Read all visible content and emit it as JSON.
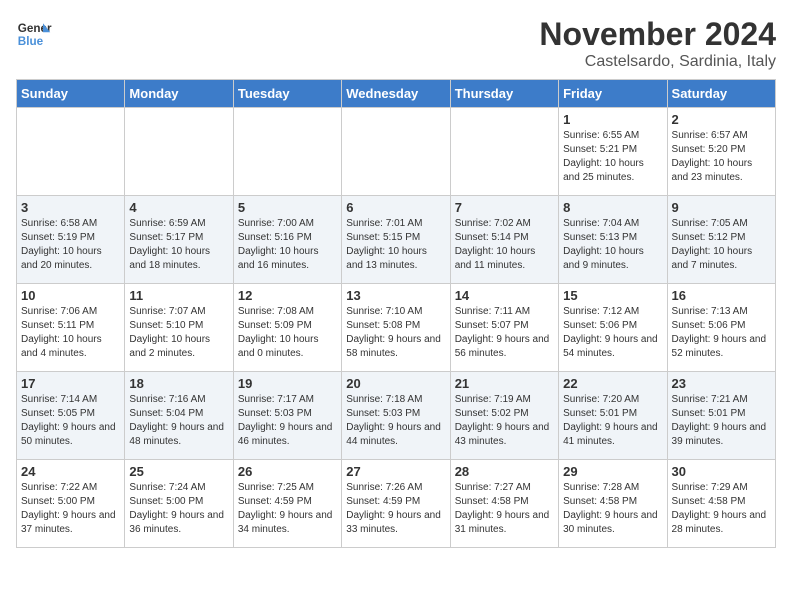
{
  "logo": {
    "name_line1": "General",
    "name_line2": "Blue"
  },
  "title": "November 2024",
  "location": "Castelsardo, Sardinia, Italy",
  "weekdays": [
    "Sunday",
    "Monday",
    "Tuesday",
    "Wednesday",
    "Thursday",
    "Friday",
    "Saturday"
  ],
  "weeks": [
    [
      {
        "day": "",
        "info": ""
      },
      {
        "day": "",
        "info": ""
      },
      {
        "day": "",
        "info": ""
      },
      {
        "day": "",
        "info": ""
      },
      {
        "day": "",
        "info": ""
      },
      {
        "day": "1",
        "info": "Sunrise: 6:55 AM\nSunset: 5:21 PM\nDaylight: 10 hours and 25 minutes."
      },
      {
        "day": "2",
        "info": "Sunrise: 6:57 AM\nSunset: 5:20 PM\nDaylight: 10 hours and 23 minutes."
      }
    ],
    [
      {
        "day": "3",
        "info": "Sunrise: 6:58 AM\nSunset: 5:19 PM\nDaylight: 10 hours and 20 minutes."
      },
      {
        "day": "4",
        "info": "Sunrise: 6:59 AM\nSunset: 5:17 PM\nDaylight: 10 hours and 18 minutes."
      },
      {
        "day": "5",
        "info": "Sunrise: 7:00 AM\nSunset: 5:16 PM\nDaylight: 10 hours and 16 minutes."
      },
      {
        "day": "6",
        "info": "Sunrise: 7:01 AM\nSunset: 5:15 PM\nDaylight: 10 hours and 13 minutes."
      },
      {
        "day": "7",
        "info": "Sunrise: 7:02 AM\nSunset: 5:14 PM\nDaylight: 10 hours and 11 minutes."
      },
      {
        "day": "8",
        "info": "Sunrise: 7:04 AM\nSunset: 5:13 PM\nDaylight: 10 hours and 9 minutes."
      },
      {
        "day": "9",
        "info": "Sunrise: 7:05 AM\nSunset: 5:12 PM\nDaylight: 10 hours and 7 minutes."
      }
    ],
    [
      {
        "day": "10",
        "info": "Sunrise: 7:06 AM\nSunset: 5:11 PM\nDaylight: 10 hours and 4 minutes."
      },
      {
        "day": "11",
        "info": "Sunrise: 7:07 AM\nSunset: 5:10 PM\nDaylight: 10 hours and 2 minutes."
      },
      {
        "day": "12",
        "info": "Sunrise: 7:08 AM\nSunset: 5:09 PM\nDaylight: 10 hours and 0 minutes."
      },
      {
        "day": "13",
        "info": "Sunrise: 7:10 AM\nSunset: 5:08 PM\nDaylight: 9 hours and 58 minutes."
      },
      {
        "day": "14",
        "info": "Sunrise: 7:11 AM\nSunset: 5:07 PM\nDaylight: 9 hours and 56 minutes."
      },
      {
        "day": "15",
        "info": "Sunrise: 7:12 AM\nSunset: 5:06 PM\nDaylight: 9 hours and 54 minutes."
      },
      {
        "day": "16",
        "info": "Sunrise: 7:13 AM\nSunset: 5:06 PM\nDaylight: 9 hours and 52 minutes."
      }
    ],
    [
      {
        "day": "17",
        "info": "Sunrise: 7:14 AM\nSunset: 5:05 PM\nDaylight: 9 hours and 50 minutes."
      },
      {
        "day": "18",
        "info": "Sunrise: 7:16 AM\nSunset: 5:04 PM\nDaylight: 9 hours and 48 minutes."
      },
      {
        "day": "19",
        "info": "Sunrise: 7:17 AM\nSunset: 5:03 PM\nDaylight: 9 hours and 46 minutes."
      },
      {
        "day": "20",
        "info": "Sunrise: 7:18 AM\nSunset: 5:03 PM\nDaylight: 9 hours and 44 minutes."
      },
      {
        "day": "21",
        "info": "Sunrise: 7:19 AM\nSunset: 5:02 PM\nDaylight: 9 hours and 43 minutes."
      },
      {
        "day": "22",
        "info": "Sunrise: 7:20 AM\nSunset: 5:01 PM\nDaylight: 9 hours and 41 minutes."
      },
      {
        "day": "23",
        "info": "Sunrise: 7:21 AM\nSunset: 5:01 PM\nDaylight: 9 hours and 39 minutes."
      }
    ],
    [
      {
        "day": "24",
        "info": "Sunrise: 7:22 AM\nSunset: 5:00 PM\nDaylight: 9 hours and 37 minutes."
      },
      {
        "day": "25",
        "info": "Sunrise: 7:24 AM\nSunset: 5:00 PM\nDaylight: 9 hours and 36 minutes."
      },
      {
        "day": "26",
        "info": "Sunrise: 7:25 AM\nSunset: 4:59 PM\nDaylight: 9 hours and 34 minutes."
      },
      {
        "day": "27",
        "info": "Sunrise: 7:26 AM\nSunset: 4:59 PM\nDaylight: 9 hours and 33 minutes."
      },
      {
        "day": "28",
        "info": "Sunrise: 7:27 AM\nSunset: 4:58 PM\nDaylight: 9 hours and 31 minutes."
      },
      {
        "day": "29",
        "info": "Sunrise: 7:28 AM\nSunset: 4:58 PM\nDaylight: 9 hours and 30 minutes."
      },
      {
        "day": "30",
        "info": "Sunrise: 7:29 AM\nSunset: 4:58 PM\nDaylight: 9 hours and 28 minutes."
      }
    ]
  ]
}
